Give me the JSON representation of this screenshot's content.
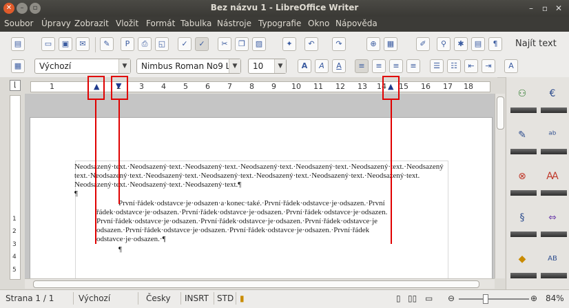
{
  "window": {
    "title": "Bez názvu 1 - LibreOffice Writer"
  },
  "menu": [
    "Soubor",
    "Úpravy",
    "Zobrazit",
    "Vložit",
    "Formát",
    "Tabulka",
    "Nástroje",
    "Typografie",
    "Okno",
    "Nápověda"
  ],
  "toolbar": {
    "find_label": "Najít text"
  },
  "format": {
    "style": "Výchozí",
    "font": "Nimbus Roman No9 L",
    "size": "10"
  },
  "ruler": {
    "numbers": [
      "1",
      "2",
      "3",
      "4",
      "5",
      "6",
      "7",
      "8",
      "9",
      "10",
      "11",
      "12",
      "13",
      "14",
      "15",
      "16",
      "17",
      "18"
    ]
  },
  "document": {
    "para1": [
      "Neodsazený·text.·Neodsazený·text.·Neodsazený·text.·Neodsazený·text.·Neodsazený·text.·Neodsazený·text.·Neodsazený",
      "text.·Neodsazený·text.·Neodsazený·text.·Neodsazený·text.·Neodsazený·text.·Neodsazený·text.·Neodsazený·text.",
      "Neodsazený·text.·Neodsazený·text.·Neodsazený·text.¶"
    ],
    "empty_mark": "¶",
    "para2_first": "První·řádek·odstavce·je·odsazen·a·konec·také.·První·řádek·odstavce·je·odsazen.·První",
    "para2_rest": [
      "řádek·odstavce·je·odsazen.·První·řádek·odstavce·je·odsazen.·První·řádek·odstavce·je·odsazen.",
      "První·řádek·odstavce·je·odsazen.·První·řádek·odstavce·je·odsazen.·První·řádek·odstavce·je",
      "odsazen.·První·řádek·odstavce·je·odsazen.·První·řádek·odstavce·je·odsazen.·První·řádek",
      "odstavce·je·odsazen.·¶"
    ],
    "para3": "¶"
  },
  "vruler_numbers": [
    "1",
    "2",
    "3",
    "4",
    "5"
  ],
  "status": {
    "page": "Strana 1 / 1",
    "style": "Výchozí",
    "lang": "Česky",
    "mode": "INSRT",
    "sel": "STD",
    "zoom": "84%"
  }
}
